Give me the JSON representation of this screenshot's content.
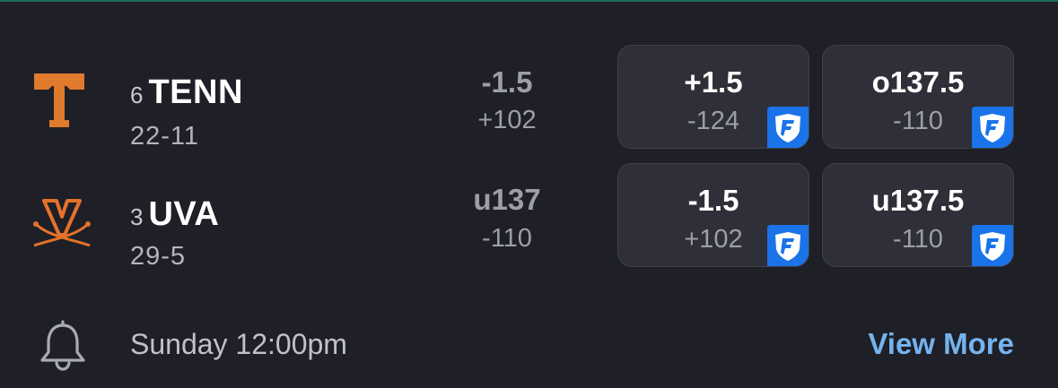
{
  "teams": [
    {
      "rank": "6",
      "abbr": "TENN",
      "record": "22-11",
      "logo_icon": "tennessee-power-t-logo",
      "logo_color": "#e07a2c",
      "odds_main": "-1.5",
      "odds_sub": "+102",
      "spread": {
        "line": "+1.5",
        "price": "-124"
      },
      "total": {
        "line": "o137.5",
        "price": "-110"
      }
    },
    {
      "rank": "3",
      "abbr": "UVA",
      "record": "29-5",
      "logo_icon": "virginia-v-sabres-logo",
      "logo_color": "#e5722a",
      "odds_main": "u137",
      "odds_sub": "-110",
      "spread": {
        "line": "-1.5",
        "price": "+102"
      },
      "total": {
        "line": "u137.5",
        "price": "-110"
      }
    }
  ],
  "sportsbook_icon": "fanduel-shield-icon",
  "sportsbook_color": "#1a73e8",
  "footer": {
    "bell_icon": "bell-icon",
    "game_time": "Sunday 12:00pm",
    "view_more": "View More"
  },
  "colors": {
    "background": "#1e1f27",
    "button_bg": "#2e2f38",
    "link": "#74b3ee"
  }
}
